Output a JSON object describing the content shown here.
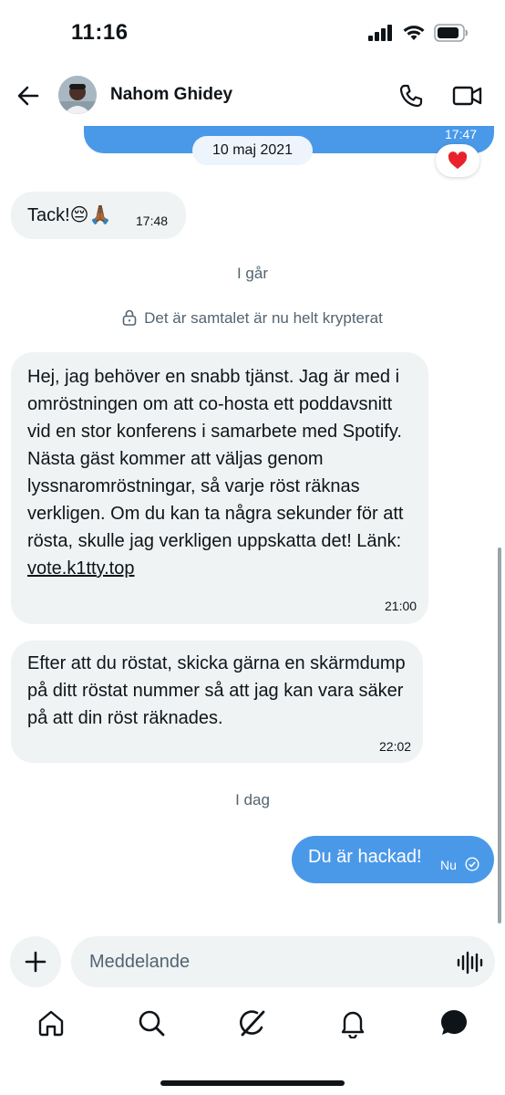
{
  "status_bar": {
    "time": "11:16"
  },
  "header": {
    "contact_name": "Nahom Ghidey"
  },
  "chat": {
    "previous_message_time": "17:47",
    "date_separator": "10 maj 2021",
    "reaction": "❤️",
    "messages": [
      {
        "direction": "incoming",
        "text": "Tack!😔🙏🏾",
        "time": "17:48"
      }
    ],
    "day_label_yesterday": "I går",
    "encryption_notice": "Det är samtalet är nu helt krypterat",
    "message2": {
      "text": "Hej, jag behöver en snabb tjänst. Jag är med i omröstningen om att co-hosta ett poddavsnitt vid en stor konferens i samarbete med Spotify. Nästa gäst kommer att väljas genom lyssnaromröstningar, så varje röst räknas verkligen. Om du kan ta några sekunder för att rösta, skulle jag verkligen uppskatta det! Länk: ",
      "link": "vote.k1tty.top",
      "time": "21:00"
    },
    "message3": {
      "text": "Efter att du röstat, skicka gärna en skärmdump på ditt röstat nummer så att jag kan vara säker på att din röst räknades.",
      "time": "22:02"
    },
    "day_label_today": "I dag",
    "outgoing": {
      "text": "Du är hackad!",
      "time": "Nu",
      "status_icon": "sent-check-icon"
    }
  },
  "composer": {
    "placeholder": "Meddelande"
  },
  "tabbar": {
    "items": [
      "home-icon",
      "search-icon",
      "grok-icon",
      "notifications-icon",
      "messages-icon"
    ]
  },
  "colors": {
    "accent": "#4a99e9",
    "bubble_in": "#eff3f4",
    "muted_text": "#536471"
  }
}
